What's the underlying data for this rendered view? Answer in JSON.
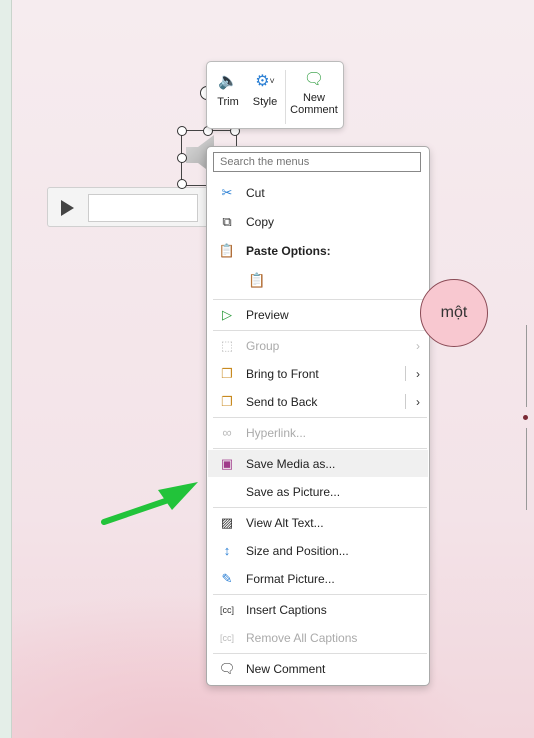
{
  "mini_toolbar": {
    "trim": "Trim",
    "style": "Style",
    "new_comment_line1": "New",
    "new_comment_line2": "Comment"
  },
  "menu": {
    "search_placeholder": "Search the menus",
    "items": [
      {
        "label": "Cut",
        "icon": "scissors-icon"
      },
      {
        "label": "Copy",
        "icon": "copy-icon"
      },
      {
        "label": "Paste Options:",
        "icon": "paste-icon"
      },
      {
        "label": "Preview",
        "icon": "play-icon"
      },
      {
        "label": "Group",
        "icon": "group-icon",
        "disabled": true
      },
      {
        "label": "Bring to Front",
        "icon": "bring-front-icon"
      },
      {
        "label": "Send to Back",
        "icon": "send-back-icon"
      },
      {
        "label": "Hyperlink...",
        "icon": "link-icon",
        "disabled": true
      },
      {
        "label": "Save Media as...",
        "icon": "save-media-icon",
        "highlighted": true
      },
      {
        "label": "Save as Picture...",
        "icon": ""
      },
      {
        "label": "View Alt Text...",
        "icon": "alt-text-icon"
      },
      {
        "label": "Size and Position...",
        "icon": "size-icon"
      },
      {
        "label": "Format Picture...",
        "icon": "format-icon"
      },
      {
        "label": "Insert Captions",
        "icon": "captions-icon"
      },
      {
        "label": "Remove All Captions",
        "icon": "remove-captions-icon",
        "disabled": true
      },
      {
        "label": "New Comment",
        "icon": "comment-icon"
      }
    ]
  },
  "slide": {
    "circle_text": "một"
  },
  "colors": {
    "accent_arrow": "#22c33a",
    "circle_fill": "#f8c8d0"
  }
}
